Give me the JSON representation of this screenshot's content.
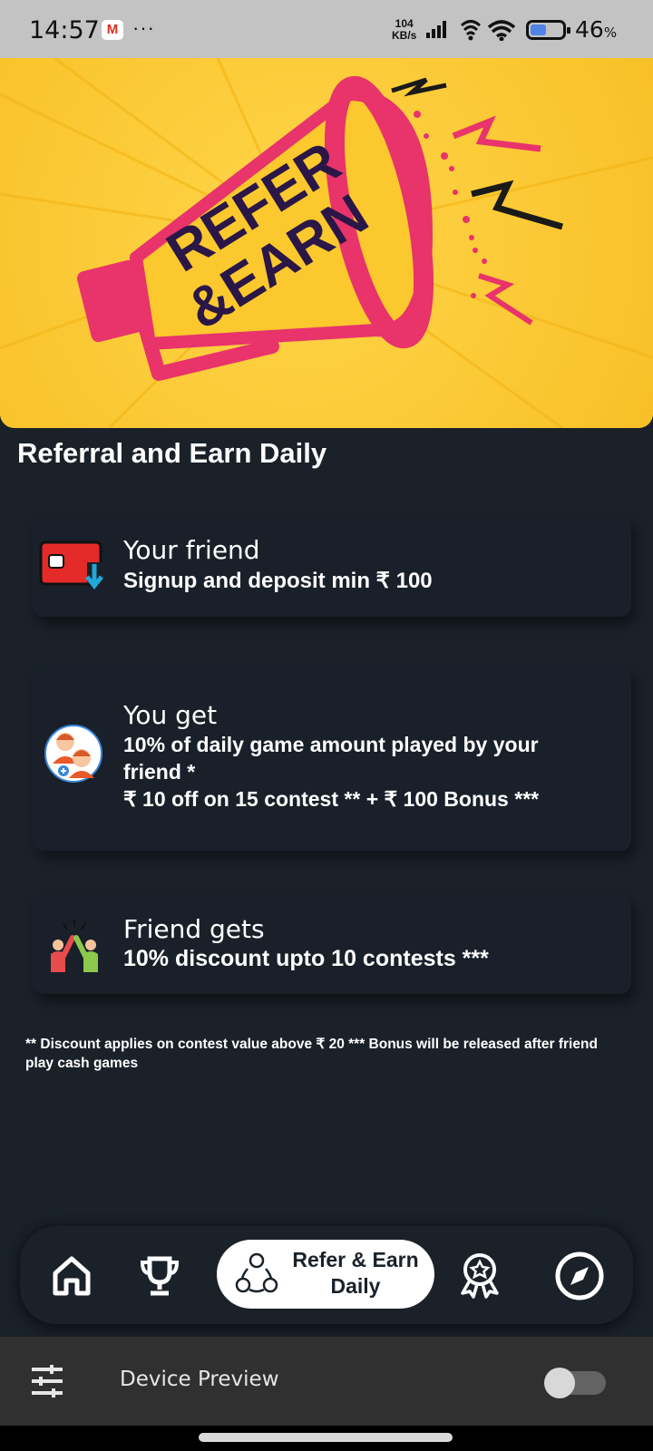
{
  "status_bar": {
    "time": "14:57",
    "notification_icon": "gmail-icon",
    "overflow": "···",
    "net_speed_value": "104",
    "net_speed_unit": "KB/s",
    "battery_percent": "46",
    "battery_percent_sign": "%",
    "battery_level": 0.46
  },
  "hero": {
    "banner_text_line1": "REFER",
    "banner_text_line2": "&EARN"
  },
  "section_title": "Referral and Earn Daily",
  "cards": [
    {
      "icon": "wallet-deposit-icon",
      "subtitle": "Your friend",
      "lines": [
        "Signup and deposit min ₹ 100"
      ]
    },
    {
      "icon": "friends-avatar-icon",
      "subtitle": "You get",
      "lines": [
        "10% of daily game amount played by your",
        "friend *",
        "₹ 10 off on 15 contest ** + ₹ 100 Bonus ***"
      ]
    },
    {
      "icon": "high-five-icon",
      "subtitle": "Friend gets",
      "lines": [
        "10% discount upto 10 contests ***"
      ]
    }
  ],
  "footnote": "** Discount applies on contest value above ₹ 20 *** Bonus will be  released after friend play cash games",
  "bottom_nav": {
    "items": [
      {
        "icon": "home-icon"
      },
      {
        "icon": "trophy-icon"
      },
      {
        "icon": "share-icon",
        "label_line1": "Refer & Earn",
        "label_line2": "Daily",
        "active": true
      },
      {
        "icon": "award-ribbon-icon"
      },
      {
        "icon": "compass-icon"
      }
    ]
  },
  "device_preview": {
    "icon": "settings-sliders-icon",
    "label": "Device Preview",
    "toggle_on": false
  },
  "colors": {
    "background": "#1a2129",
    "hero_yellow": "#fbc82d",
    "megaphone_pink": "#e8336b",
    "text_navy": "#2a1747",
    "accent_red": "#e8336b"
  }
}
